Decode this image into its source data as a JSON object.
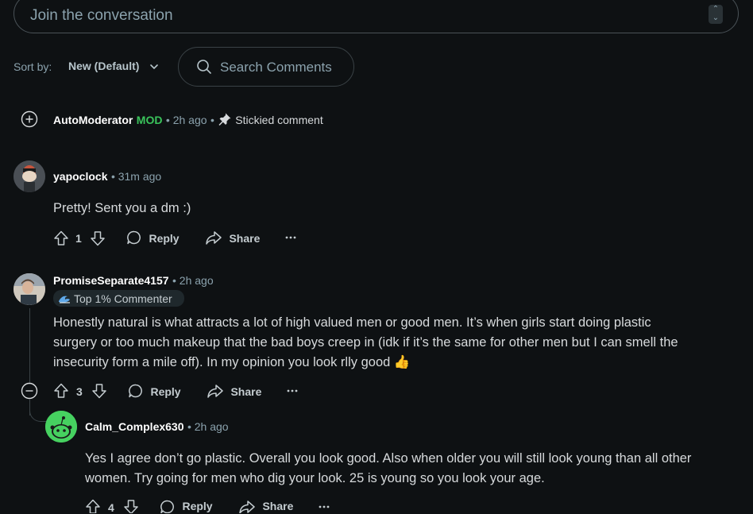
{
  "composer": {
    "placeholder": "Join the conversation"
  },
  "sort": {
    "label": "Sort by:",
    "value": "New (Default)"
  },
  "search": {
    "placeholder": "Search Comments"
  },
  "comments": [
    {
      "author": "AutoModerator",
      "tag": "MOD",
      "time": "2h ago",
      "sticky": "Stickied comment"
    },
    {
      "author": "yapoclock",
      "time": "31m ago",
      "body": "Pretty! Sent you a dm :)",
      "votes": "1",
      "reply": "Reply",
      "share": "Share"
    },
    {
      "author": "PromiseSeparate4157",
      "time": "2h ago",
      "flair": "Top 1% Commenter",
      "body_lines": [
        "Honestly natural is what attracts a lot of high valued men or good men. It’s when girls start doing plastic",
        "surgery or too much makeup that the bad boys creep in (idk if it’s the same for other men but I can smell the",
        "insecurity form a mile off). In my opinion you look rlly good 👍"
      ],
      "votes": "3",
      "reply": "Reply",
      "share": "Share"
    },
    {
      "author": "Calm_Complex630",
      "time": "2h ago",
      "body_lines": [
        "Yes I agree don’t go plastic. Overall you look good. Also when older you will still look young than all other",
        "women. Try going for men who dig your look. 25 is young so you look your age."
      ],
      "votes": "4",
      "reply": "Reply",
      "share": "Share"
    }
  ],
  "icons": {
    "expand": "plus-circle-icon",
    "collapse": "minus-circle-icon",
    "upvote": "arrow-up-icon",
    "downvote": "arrow-down-icon",
    "reply": "speech-bubble-icon",
    "share": "share-arrow-icon",
    "more": "ellipsis-icon",
    "pin": "pushpin-icon",
    "search": "magnifier-icon"
  },
  "colors": {
    "background": "#0e1113",
    "mod": "#3ac45b",
    "muted": "#8ba2ad"
  }
}
